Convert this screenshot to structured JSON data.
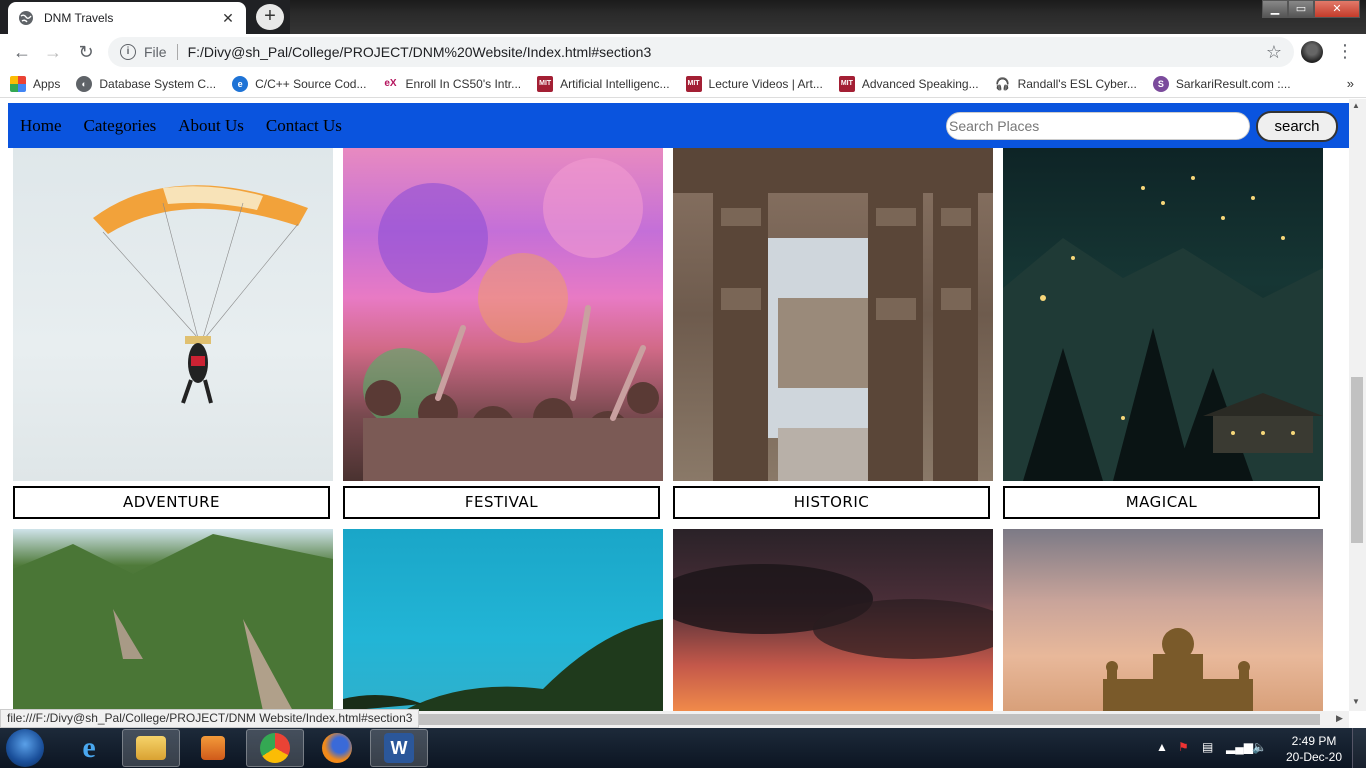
{
  "browser": {
    "tab_title": "DNM Travels",
    "omnibox_scheme": "File",
    "url": "F:/Divy@sh_Pal/College/PROJECT/DNM%20Website/Index.html#section3",
    "status_url": "file:///F:/Divy@sh_Pal/College/PROJECT/DNM Website/Index.html#section3"
  },
  "bookmarks": [
    {
      "label": "Apps",
      "icon": "apps-grid-icon"
    },
    {
      "label": "Database System C...",
      "icon": "globe-icon"
    },
    {
      "label": "C/C++ Source Cod...",
      "icon": "edge-icon"
    },
    {
      "label": "Enroll In CS50's Intr...",
      "icon": "edx-icon"
    },
    {
      "label": "Artificial Intelligenc...",
      "icon": "mit-ocw-icon"
    },
    {
      "label": "Lecture Videos | Art...",
      "icon": "mit-ocw-icon"
    },
    {
      "label": "Advanced Speaking...",
      "icon": "mit-ocw-icon"
    },
    {
      "label": "Randall's ESL Cyber...",
      "icon": "headphones-icon"
    },
    {
      "label": "SarkariResult.com :...",
      "icon": "sarkari-icon"
    }
  ],
  "site_nav": {
    "links": [
      "Home",
      "Categories",
      "About Us",
      "Contact Us"
    ],
    "search_placeholder": "Search Places",
    "search_button": "search"
  },
  "categories": [
    "ADVENTURE",
    "FESTIVAL",
    "HISTORIC",
    "MAGICAL"
  ],
  "taskbar": {
    "time": "2:49 PM",
    "date": "20-Dec-20"
  }
}
